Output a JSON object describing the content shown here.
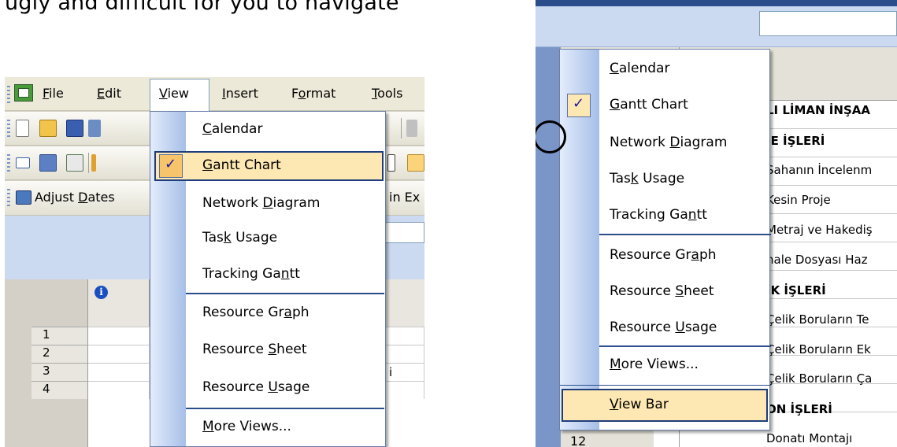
{
  "heading": "ugly and difficult for you to navigate",
  "left": {
    "menubar": {
      "app_icon": "msproject-app-icon",
      "items": [
        {
          "label": "File",
          "key": "F",
          "rest": "ile"
        },
        {
          "label": "Edit",
          "key": "E",
          "rest": "dit"
        },
        {
          "label": "View",
          "key": "V",
          "rest": "iew"
        },
        {
          "label": "Insert",
          "key": "I",
          "rest": "nsert"
        },
        {
          "label": "Format",
          "key": "o",
          "pre": "F",
          "rest": "rmat"
        },
        {
          "label": "Tools",
          "key": "T",
          "rest": "ools"
        }
      ]
    },
    "toolbar3": {
      "adjust_dates": "Adjust Dates",
      "in_ex": "in Ex"
    },
    "grid": {
      "rows": [
        "1",
        "2",
        "3",
        "4"
      ],
      "partial_cell": "i"
    },
    "view_menu": {
      "items": [
        {
          "label": "Calendar",
          "checked": false
        },
        {
          "label": "Gantt Chart",
          "checked": true,
          "highlighted": true
        },
        {
          "label": "Network Diagram",
          "checked": false
        },
        {
          "label": "Task Usage",
          "checked": false
        },
        {
          "label": "Tracking Gantt",
          "checked": false
        },
        {
          "label": "Resource Graph",
          "checked": false
        },
        {
          "label": "Resource Sheet",
          "checked": false
        },
        {
          "label": "Resource Usage",
          "checked": false
        },
        {
          "label": "More Views...",
          "checked": false
        }
      ]
    }
  },
  "right": {
    "view_menu": {
      "items": [
        {
          "label": "Calendar"
        },
        {
          "label": "Gantt Chart",
          "checked": true
        },
        {
          "label": "Network Diagram"
        },
        {
          "label": "Task Usage"
        },
        {
          "label": "Tracking Gantt"
        },
        {
          "label": "Resource Graph"
        },
        {
          "label": "Resource Sheet"
        },
        {
          "label": "Resource Usage"
        },
        {
          "label": "More Views..."
        },
        {
          "label": "View Bar",
          "highlighted": true
        }
      ]
    },
    "tasks": [
      {
        "text": "LI LİMAN İNŞAA",
        "bold": true
      },
      {
        "text": "JE İŞLERİ",
        "bold": true
      },
      {
        "text": "Sahanın İncelenm",
        "bold": false
      },
      {
        "text": "Kesin Proje",
        "bold": false
      },
      {
        "text": "Metraj ve Hakediş",
        "bold": false
      },
      {
        "text": "hale Dosyası Haz",
        "bold": false
      },
      {
        "text": "IK İŞLERİ",
        "bold": true
      },
      {
        "text": "Çelik Boruların Te",
        "bold": false
      },
      {
        "text": "Çelik Boruların Ek",
        "bold": false
      },
      {
        "text": "Çelik Boruların Ça",
        "bold": false
      },
      {
        "text": "ON İŞLERİ",
        "bold": true
      },
      {
        "text": "Donatı Montajı",
        "bold": false
      }
    ],
    "last_row_number": "12"
  },
  "colors": {
    "menu_highlight": "#fde7b2",
    "menu_border": "#1e3d7a",
    "check_bg": "#f7c46b",
    "xp_blue": "#7a96c9"
  }
}
